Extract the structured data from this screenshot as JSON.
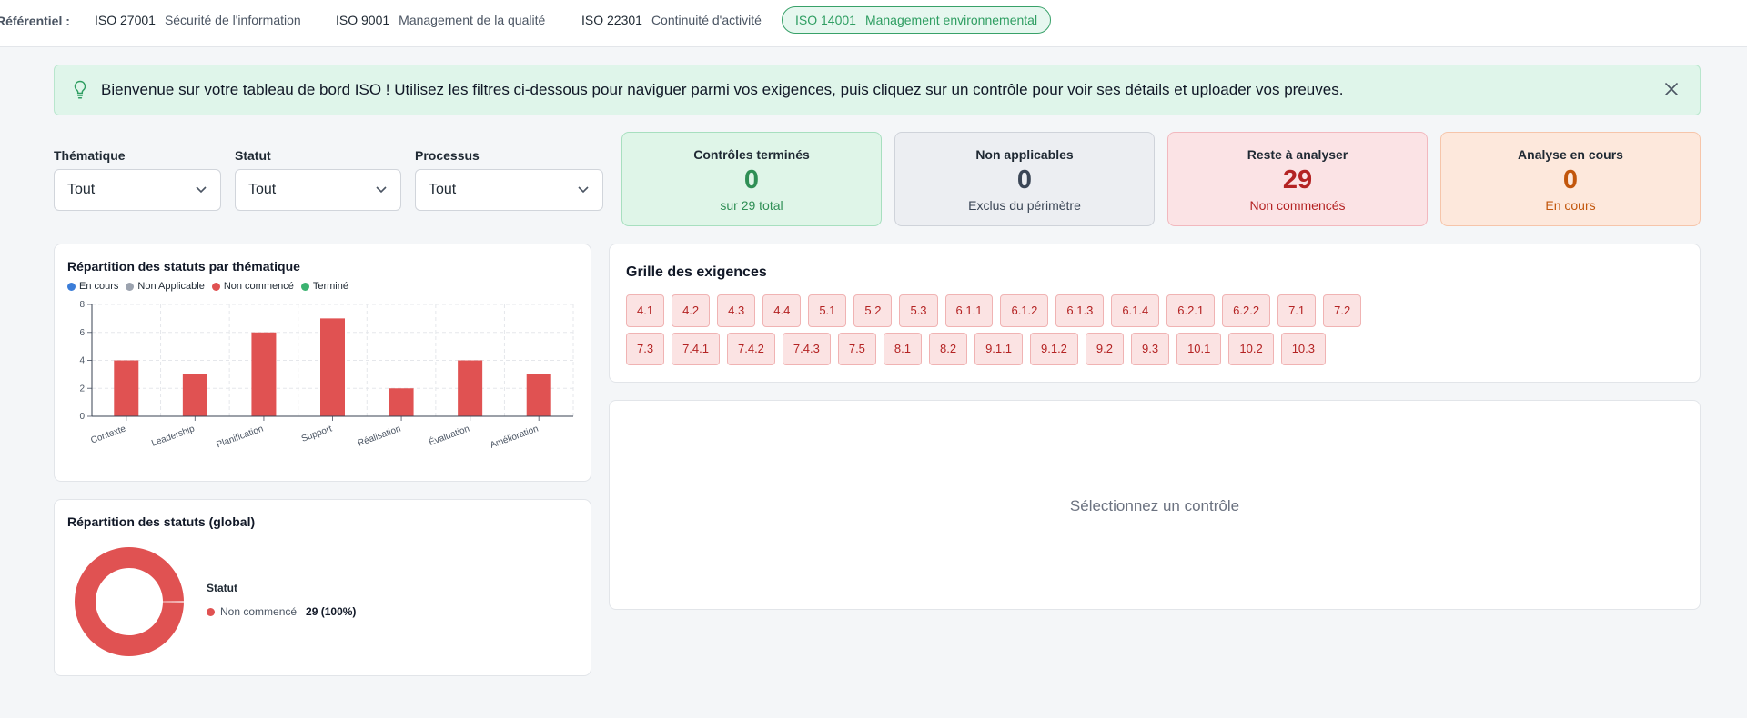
{
  "topbar": {
    "label": "Référentiel :",
    "standards": [
      {
        "code": "ISO 27001",
        "desc": "Sécurité de l'information",
        "active": false
      },
      {
        "code": "ISO 9001",
        "desc": "Management de la qualité",
        "active": false
      },
      {
        "code": "ISO 22301",
        "desc": "Continuité d'activité",
        "active": false
      },
      {
        "code": "ISO 14001",
        "desc": "Management environnemental",
        "active": true
      }
    ]
  },
  "banner": {
    "text": "Bienvenue sur votre tableau de bord ISO ! Utilisez les filtres ci-dessous pour naviguer parmi vos exigences, puis cliquez sur un contrôle pour voir ses détails et uploader vos preuves.",
    "icon": "lightbulb-icon",
    "close_icon": "close-icon"
  },
  "filters": [
    {
      "label": "Thématique",
      "value": "Tout"
    },
    {
      "label": "Statut",
      "value": "Tout"
    },
    {
      "label": "Processus",
      "value": "Tout"
    }
  ],
  "kpis": [
    {
      "title": "Contrôles terminés",
      "value": "0",
      "sub": "sur 29 total",
      "bg": "#dff5e8",
      "border": "#a7dfbf",
      "color": "#2f8f55"
    },
    {
      "title": "Non applicables",
      "value": "0",
      "sub": "Exclus du périmètre",
      "bg": "#eceef2",
      "border": "#cfd3da",
      "color": "#3b4656"
    },
    {
      "title": "Reste à analyser",
      "value": "29",
      "sub": "Non commencés",
      "bg": "#fbe3e5",
      "border": "#f2b8be",
      "color": "#b42323"
    },
    {
      "title": "Analyse en cours",
      "value": "0",
      "sub": "En cours",
      "bg": "#fde8dc",
      "border": "#f6c5aa",
      "color": "#c2560c"
    }
  ],
  "bar_card": {
    "title": "Répartition des statuts par thématique",
    "legend": [
      {
        "label": "En cours",
        "color": "#3b7dd8"
      },
      {
        "label": "Non Applicable",
        "color": "#9ca3af"
      },
      {
        "label": "Non commencé",
        "color": "#e05252"
      },
      {
        "label": "Terminé",
        "color": "#3cb371"
      }
    ]
  },
  "chart_data": {
    "type": "bar",
    "categories": [
      "Contexte",
      "Leadership",
      "Planification",
      "Support",
      "Réalisation",
      "Évaluation",
      "Amélioration"
    ],
    "series": [
      {
        "name": "Non commencé",
        "values": [
          4,
          3,
          6,
          7,
          2,
          4,
          3
        ],
        "color": "#e05252"
      }
    ],
    "yticks": [
      "0",
      "2",
      "4",
      "6",
      "8"
    ],
    "ylim": [
      0,
      8
    ],
    "grid": true,
    "legend": "top-left"
  },
  "grid_card": {
    "title": "Grille des exigences",
    "rows": [
      [
        "4.1",
        "4.2",
        "4.3",
        "4.4",
        "5.1",
        "5.2",
        "5.3",
        "6.1.1",
        "6.1.2",
        "6.1.3",
        "6.1.4",
        "6.2.1",
        "6.2.2",
        "7.1",
        "7.2"
      ],
      [
        "7.3",
        "7.4.1",
        "7.4.2",
        "7.4.3",
        "7.5",
        "8.1",
        "8.2",
        "9.1.1",
        "9.1.2",
        "9.2",
        "9.3",
        "10.1",
        "10.2",
        "10.3"
      ]
    ]
  },
  "detail_card": {
    "placeholder": "Sélectionnez un contrôle"
  },
  "donut_card": {
    "title": "Répartition des statuts (global)",
    "legend_title": "Statut",
    "items": [
      {
        "label": "Non commencé",
        "value": "29 (100%)",
        "share": 100,
        "color": "#e05252"
      }
    ]
  }
}
